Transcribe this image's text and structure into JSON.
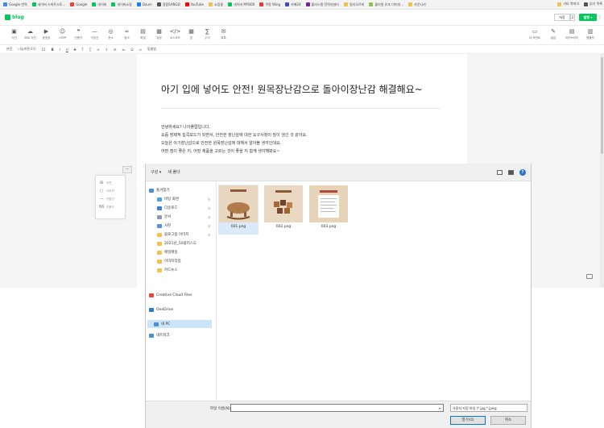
{
  "bookmarks": [
    {
      "label": "Google 번역",
      "color": "#4285f4"
    },
    {
      "label": "네이버 스마트스토...",
      "color": "#03c75a"
    },
    {
      "label": "Google",
      "color": "#ea4335"
    },
    {
      "label": "네이버",
      "color": "#03c75a"
    },
    {
      "label": "네이버쇼핑",
      "color": "#03c75a"
    },
    {
      "label": "Daum",
      "color": "#1e7df5"
    },
    {
      "label": "정합SANGD",
      "color": "#555555"
    },
    {
      "label": "YouTube",
      "color": "#ff0000"
    },
    {
      "label": "쇼핑몰",
      "color": "#f2c14e"
    },
    {
      "label": "네이버 MY8OX",
      "color": "#03c75a"
    },
    {
      "label": "쿠팡 Wing",
      "color": "#e53935"
    },
    {
      "label": "카페24",
      "color": "#3f51b5"
    },
    {
      "label": "블러스윙 전략자센터",
      "color": "#7b1fa2"
    },
    {
      "label": "밀리오르비",
      "color": "#f2c14e"
    },
    {
      "label": "블리원 유조 이미지...",
      "color": "#8bc34a"
    },
    {
      "label": "카운니카",
      "color": "#f2c14e"
    }
  ],
  "bookmarks_right": [
    {
      "label": "기타 북마크",
      "color": "#f2c14e"
    },
    {
      "label": "읽기 목록",
      "color": "#555555"
    }
  ],
  "blog": {
    "logo": "blog",
    "save_label": "저장",
    "save_count": "2",
    "publish_label": "발행 ▾",
    "menu_icon": "⋮"
  },
  "insert_tools": [
    {
      "label": "사진",
      "glyph": "▣"
    },
    {
      "label": "SNS 사진",
      "glyph": "☁"
    },
    {
      "label": "동영상",
      "glyph": "▶"
    },
    {
      "label": "스티커",
      "glyph": "☺"
    },
    {
      "label": "인용구",
      "glyph": "❝"
    },
    {
      "label": "구분선",
      "glyph": "—"
    },
    {
      "label": "장소",
      "glyph": "◎"
    },
    {
      "label": "링크",
      "glyph": "∞"
    },
    {
      "label": "파일",
      "glyph": "▤"
    },
    {
      "label": "일정",
      "glyph": "▦"
    },
    {
      "label": "소스코드",
      "glyph": "</>"
    },
    {
      "label": "표",
      "glyph": "▦"
    },
    {
      "label": "수식",
      "glyph": "∑"
    },
    {
      "label": "톡톡",
      "glyph": "✉"
    }
  ],
  "insert_tools_right": [
    {
      "label": "내 모먼트",
      "glyph": "▭"
    },
    {
      "label": "글감",
      "glyph": "✎"
    },
    {
      "label": "라이브러리",
      "glyph": "▤"
    },
    {
      "label": "템플릿",
      "glyph": "▥"
    }
  ],
  "format_bar": {
    "style": "본문",
    "font": "나눔바른고딕",
    "size": "15",
    "bold": "B",
    "italic": "I",
    "underline": "U",
    "strike": "S",
    "spellcheck": "맞춤법"
  },
  "document": {
    "title": "아기 입에 넣어도 안전! 원목장난감으로 돌아이장난감 해결해요~",
    "paragraphs": [
      "안녕하세요? 나이플랍입니다.",
      "요즘 장제적 집콕모드가 되면서, 안전한 장난감에 대한 요구사항이 많이 생긴 것 같아요.",
      "오늘은 아기장난감으로 안전한 원목장난감에 대해서 알아볼 생각인데요.",
      "어떤 점이 좋은 지, 어떤 제품을 고르는 것이 좋을 지 함께 생각해봐요~"
    ]
  },
  "side_panel": {
    "close": "−",
    "rows": [
      {
        "glyph": "⊞",
        "label": "사진"
      },
      {
        "glyph": "○",
        "label": "스티커"
      },
      {
        "glyph": "—",
        "label": "구분선"
      },
      {
        "glyph": "66",
        "label": "인용구"
      }
    ]
  },
  "dialog": {
    "organize": "구성 ▾",
    "new_folder": "새 폴더",
    "help": "?",
    "nav": [
      {
        "label": "즐겨찾기",
        "icon_color": "#4a90d9",
        "level": 0
      },
      {
        "label": "바탕 화면",
        "icon_color": "#4aa3df",
        "level": 1,
        "pinned": true
      },
      {
        "label": "다운로드",
        "icon_color": "#3d7fd9",
        "level": 1,
        "pinned": true
      },
      {
        "label": "문서",
        "icon_color": "#8c9bb0",
        "level": 1,
        "pinned": true
      },
      {
        "label": "사진",
        "icon_color": "#5b8fd1",
        "level": 1,
        "pinned": true
      },
      {
        "label": "블로그용 이미지",
        "icon_color": "#f2c14e",
        "level": 1,
        "pinned": true
      },
      {
        "label": "2021년_50플러스도",
        "icon_color": "#f2c14e",
        "level": 1
      },
      {
        "label": "매일매일",
        "icon_color": "#f2c14e",
        "level": 1
      },
      {
        "label": "이미지작업",
        "icon_color": "#f2c14e",
        "level": 1
      },
      {
        "label": "카드뉴스",
        "icon_color": "#f2c14e",
        "level": 1
      },
      {
        "label": "Creative Cloud Files",
        "icon_color": "#e8453c",
        "level": 0
      },
      {
        "label": "OneDrive",
        "icon_color": "#2c7cd6",
        "level": 0
      },
      {
        "label": "내 PC",
        "icon_color": "#4a90d9",
        "level": 0,
        "selected": true
      },
      {
        "label": "네트워크",
        "icon_color": "#4a90d9",
        "level": 0
      }
    ],
    "files": [
      {
        "name": "001.png",
        "selected": true,
        "thumb": "horse"
      },
      {
        "name": "002.png",
        "selected": false,
        "thumb": "blocks"
      },
      {
        "name": "003.png",
        "selected": false,
        "thumb": "card"
      }
    ],
    "filename_label": "파일 이름(N):",
    "filename_value": "",
    "filetype": "사용자 지정 파일 (*.jpg;*.jpeg;",
    "open_label": "열기(O)",
    "cancel_label": "취소"
  }
}
